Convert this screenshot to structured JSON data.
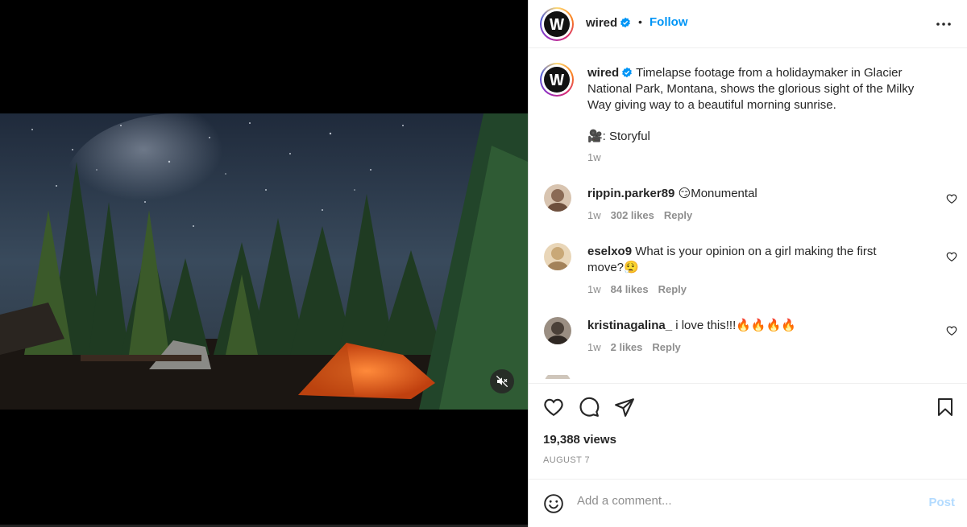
{
  "post": {
    "account": "wired",
    "follow_label": "Follow",
    "separator": "•",
    "caption_lines": [
      "Timelapse footage from a holidaymaker in Glacier",
      "National Park, Montana, shows the glorious sight of the Milky",
      "Way giving way to a beautiful morning sunrise."
    ],
    "credit": "🎥: Storyful",
    "caption_time": "1w"
  },
  "comments": [
    {
      "user": "rippin.parker89",
      "text": "😏Monumental",
      "time": "1w",
      "likes": "302 likes",
      "reply": "Reply",
      "avatar_color": "#8a6a55"
    },
    {
      "user": "eselxo9",
      "text": "What is your opinion on a girl making the first",
      "text2": "move?😮‍💨",
      "time": "1w",
      "likes": "84 likes",
      "reply": "Reply",
      "avatar_color": "#c9a877"
    },
    {
      "user": "kristinagalina_",
      "text": "i love this!!!🔥🔥🔥🔥",
      "time": "1w",
      "likes": "2 likes",
      "reply": "Reply",
      "avatar_color": "#4a4038"
    }
  ],
  "stats": {
    "views": "19,388 views",
    "date": "AUGUST 7"
  },
  "composer": {
    "placeholder": "Add a comment...",
    "post_label": "Post"
  },
  "colors": {
    "accent": "#0095f6",
    "verified": "#0095f6",
    "post_disabled": "#b3dbff",
    "tent_orange": "#e85d1a"
  },
  "icons": {
    "more": "more-horizontal-icon",
    "like": "heart-icon",
    "comment": "comment-bubble-icon",
    "share": "paper-plane-icon",
    "save": "bookmark-icon",
    "emoji": "smiley-icon",
    "mute": "muted-speaker-icon"
  }
}
